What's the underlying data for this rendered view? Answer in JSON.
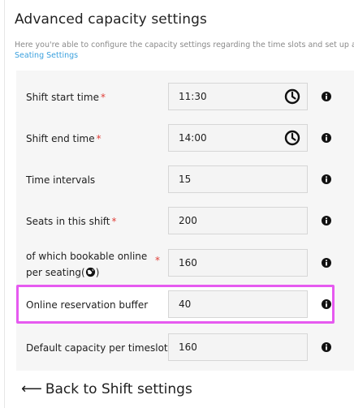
{
  "page": {
    "title": "Advanced capacity settings",
    "description": "Here you're able to configure the capacity settings regarding the time slots and set up a buffer",
    "link_label": "Seating Settings",
    "back_label": "Back to Shift settings",
    "back_arrow": "⟵"
  },
  "fields": {
    "shift_start": {
      "label": "Shift start time",
      "required": "*",
      "value": "11:30",
      "icon": "clock-icon"
    },
    "shift_end": {
      "label": "Shift end time",
      "required": "*",
      "value": "14:00",
      "icon": "clock-icon"
    },
    "time_intervals": {
      "label": "Time intervals",
      "value": "15"
    },
    "seats": {
      "label": "Seats in this shift",
      "required": "*",
      "value": "200"
    },
    "bookable": {
      "label_line1": "of which bookable online",
      "label_line2": "per seating(",
      "label_close": ")",
      "required": "*",
      "value": "160",
      "icon": "globe-icon"
    },
    "buffer": {
      "label": "Online reservation buffer",
      "value": "40"
    },
    "default_capacity": {
      "label": "Default capacity per timeslot",
      "value": "160"
    }
  },
  "colors": {
    "accent_link": "#3aa0de",
    "required": "#e0403a",
    "highlight": "#e65af0"
  }
}
